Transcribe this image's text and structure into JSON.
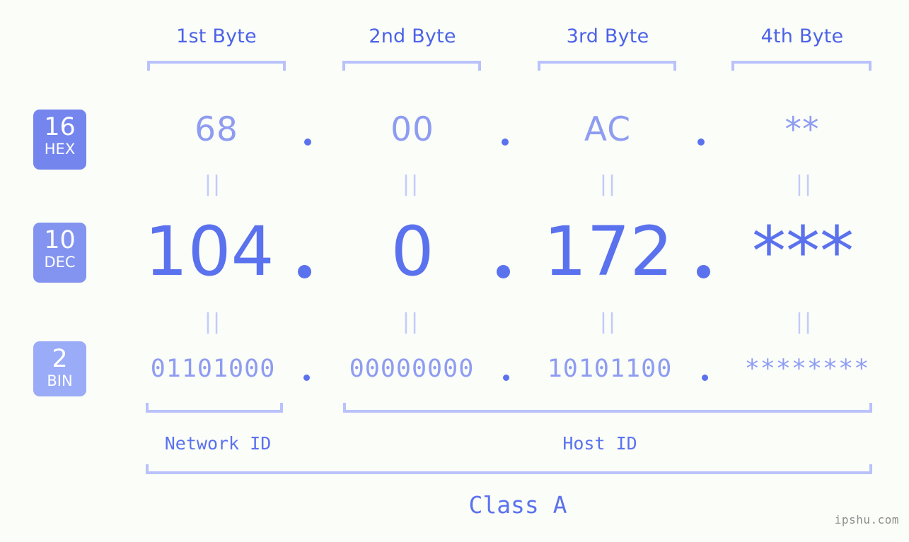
{
  "background_color": "#fbfdf8",
  "accent_color": "#5b72ee",
  "bracket_color": "#b9c2fb",
  "byte_headers": [
    {
      "label": "1st Byte"
    },
    {
      "label": "2nd Byte"
    },
    {
      "label": "3rd Byte"
    },
    {
      "label": "4th Byte"
    }
  ],
  "rows": {
    "hex": {
      "badge_number": "16",
      "badge_label": "HEX",
      "badge_color": "#7485ee",
      "values": [
        "68",
        "00",
        "AC",
        "**"
      ],
      "separator": "."
    },
    "dec": {
      "badge_number": "10",
      "badge_label": "DEC",
      "badge_color": "#8294f0",
      "values": [
        "104",
        "0",
        "172",
        "***"
      ],
      "separator": "."
    },
    "bin": {
      "badge_number": "2",
      "badge_label": "BIN",
      "badge_color": "#9aabf7",
      "values": [
        "01101000",
        "00000000",
        "10101100",
        "********"
      ],
      "separator": "."
    }
  },
  "equals_marks": {
    "glyph": "||",
    "hex_to_dec": [
      "||",
      "||",
      "||",
      "||"
    ],
    "dec_to_bin": [
      "||",
      "||",
      "||",
      "||"
    ]
  },
  "segments": {
    "network_id": "Network ID",
    "host_id": "Host ID",
    "class": "Class A"
  },
  "watermark": "ipshu.com"
}
